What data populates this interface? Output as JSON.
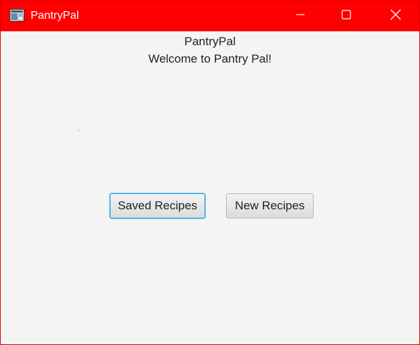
{
  "window": {
    "title": "PantryPal",
    "controls": {
      "minimize": "minimize-icon",
      "maximize": "maximize-icon",
      "close": "close-icon"
    },
    "titlebar_color": "#ff0000"
  },
  "main": {
    "app_name": "PantryPal",
    "welcome_text": "Welcome to Pantry Pal!",
    "buttons": {
      "saved_recipes": "Saved Recipes",
      "new_recipes": "New Recipes"
    },
    "focused_button": "saved_recipes",
    "focus_color": "#2aa3e0"
  }
}
